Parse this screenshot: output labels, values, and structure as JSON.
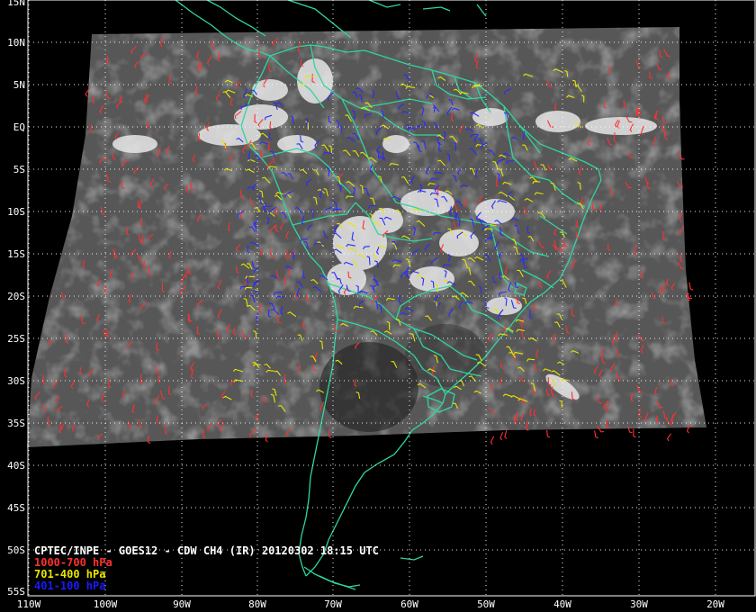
{
  "title": "CPTEC/INPE - GOES12 - CDW CH4 (IR) 20120302 18:15 UTC",
  "latitude_labels": [
    "15N",
    "10N",
    "5N",
    "EQ",
    "5S",
    "10S",
    "15S",
    "20S",
    "25S",
    "30S",
    "35S",
    "40S",
    "45S",
    "50S",
    "55S"
  ],
  "longitude_labels": [
    "110W",
    "100W",
    "90W",
    "80W",
    "70W",
    "60W",
    "50W",
    "40W",
    "30W",
    "20W"
  ],
  "legend": [
    {
      "label": "1000-700 hPa",
      "color": "#ff3030"
    },
    {
      "label": "701-400 hPa",
      "color": "#e6e600"
    },
    {
      "label": "401-100 hPa",
      "color": "#1a1aff"
    }
  ],
  "colors": {
    "background": "#000000",
    "coastline": "#2fd6a0",
    "grid": "#ffffff",
    "ir_image": "#555555"
  }
}
